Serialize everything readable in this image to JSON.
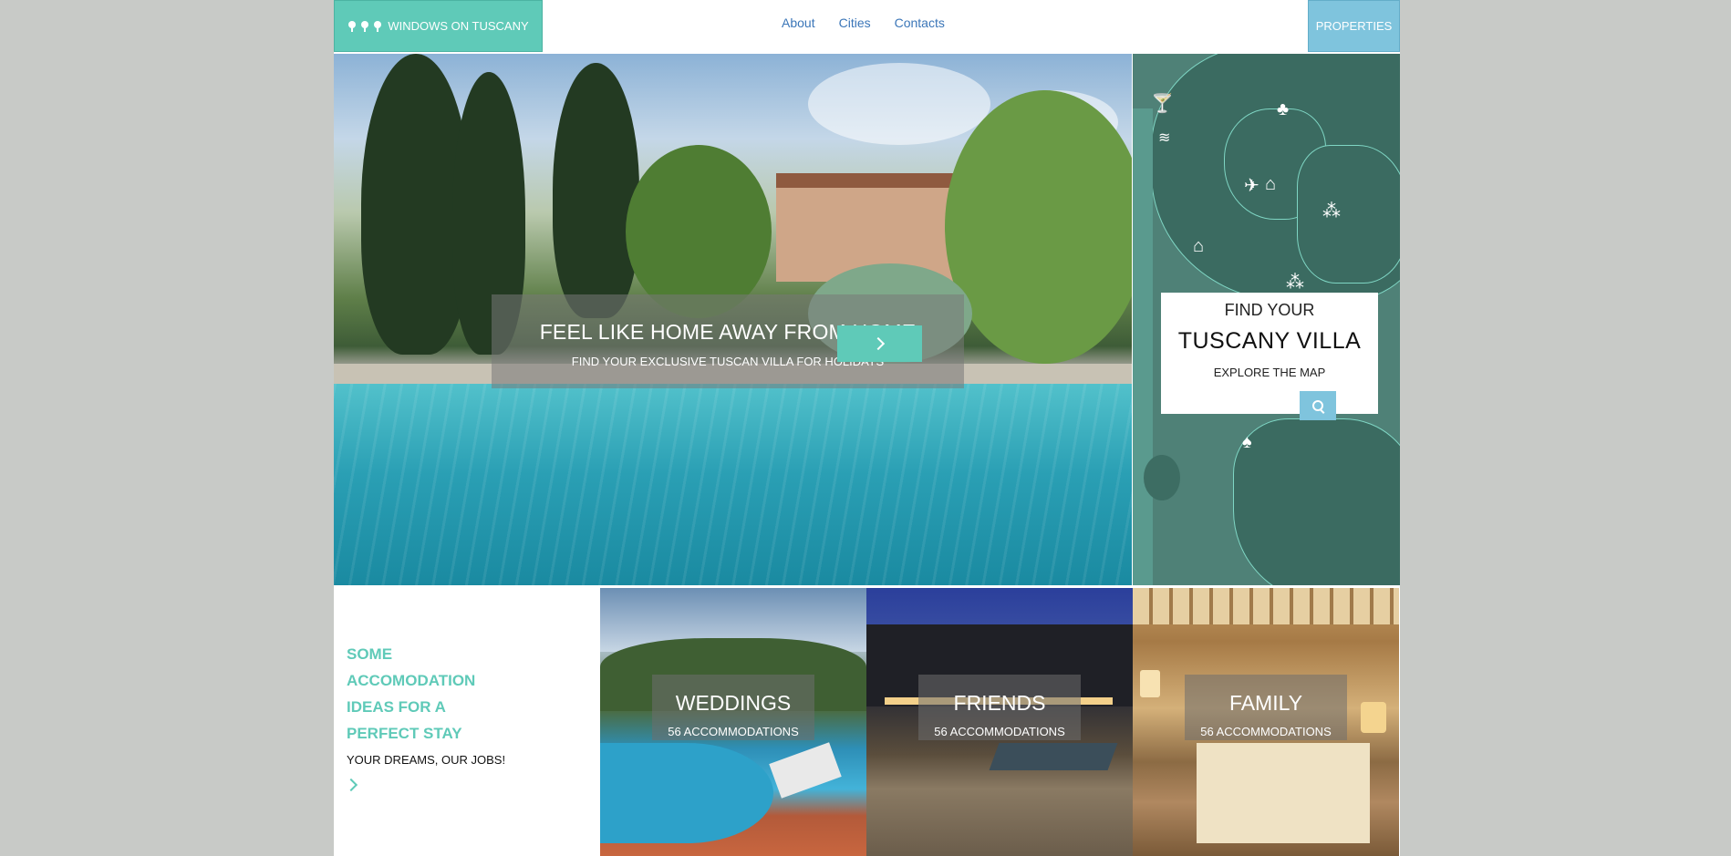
{
  "header": {
    "logo_text": "WINDOWS ON TUSCANY",
    "nav": [
      "About",
      "Cities",
      "Contacts"
    ],
    "properties_label": "PROPERTIES"
  },
  "hero": {
    "title": "FEEL LIKE HOME AWAY FROM HOME",
    "subtitle": "FIND YOUR EXCLUSIVE TUSCAN VILLA FOR HOLIDAYS"
  },
  "map_card": {
    "line1": "FIND YOUR",
    "line2": "TUSCANY VILLA",
    "line3": "EXPLORE THE MAP"
  },
  "ideas": {
    "title": "SOME ACCOMODATION IDEAS FOR A PERFECT STAY",
    "subtitle": "YOUR DREAMS, OUR JOBS!"
  },
  "categories": [
    {
      "title": "WEDDINGS",
      "count": "56 ACCOMMODATIONS"
    },
    {
      "title": "FRIENDS",
      "count": "56 ACCOMMODATIONS"
    },
    {
      "title": "FAMILY",
      "count": "56 ACCOMMODATIONS"
    }
  ],
  "colors": {
    "accent_teal": "#5fcab8",
    "accent_blue": "#7fc4dd",
    "link_blue": "#3b76b8",
    "map_green": "#4f8177"
  },
  "icons": [
    "tree-icon",
    "chevron-right-icon",
    "search-icon",
    "cocktail-icon",
    "hiking-icon",
    "waves-icon",
    "plane-icon",
    "museum-icon",
    "grapes-icon",
    "dining-icon"
  ]
}
